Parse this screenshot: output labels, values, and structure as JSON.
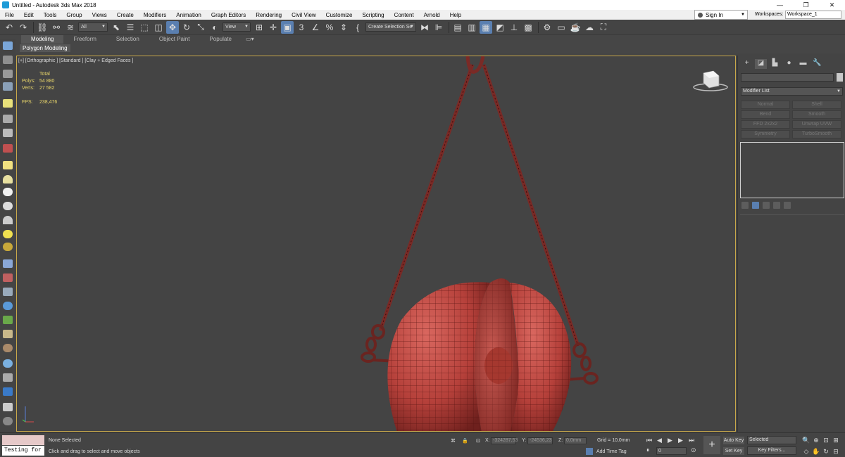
{
  "window": {
    "title": "Untitled - Autodesk 3ds Max 2018",
    "min": "—",
    "max": "❐",
    "close": "✕"
  },
  "menu": [
    "File",
    "Edit",
    "Tools",
    "Group",
    "Views",
    "Create",
    "Modifiers",
    "Animation",
    "Graph Editors",
    "Rendering",
    "Civil View",
    "Customize",
    "Scripting",
    "Content",
    "Arnold",
    "Help"
  ],
  "account": {
    "sign_in": "Sign In",
    "workspaces_label": "Workspaces:",
    "workspace": "Workspace_1"
  },
  "toolbar": {
    "selection_filter": "All",
    "ref_coord": "View",
    "named_selection": "Create Selection Se"
  },
  "ribbon": {
    "tabs": [
      "Modeling",
      "Freeform",
      "Selection",
      "Object Paint",
      "Populate"
    ],
    "active_tab": "Modeling",
    "sub_label": "Polygon Modeling"
  },
  "viewport": {
    "label": "[+] [Orthographic ] [Standard ] [Clay + Edged Faces ]",
    "stats": {
      "total_label": "Total",
      "polys_label": "Polys:",
      "polys": "54 880",
      "verts_label": "Verts:",
      "verts": "27 582",
      "fps_label": "FPS:",
      "fps": "238,476"
    }
  },
  "command_panel": {
    "modifier_list": "Modifier List",
    "modifiers": [
      "Normal",
      "Shell",
      "Bend",
      "Smooth",
      "FFD 2x2x2",
      "Unwrap UVW",
      "Symmetry",
      "TurboSmooth"
    ]
  },
  "status": {
    "script_input": "Testing for :",
    "selection": "None Selected",
    "prompt": "Click and drag to select and move objects",
    "x_label": "X:",
    "x": "-324287,53",
    "y_label": "Y:",
    "y": "-24536,23",
    "z_label": "Z:",
    "z": "0,0mm",
    "grid": "Grid = 10,0mm",
    "add_time_tag": "Add Time Tag",
    "frame": "0",
    "auto_key": "Auto Key",
    "set_key": "Set Key",
    "key_mode": "Selected",
    "key_filters": "Key Filters..."
  },
  "colors": {
    "accent": "#5a7fb0",
    "viewport_border": "#c8a84a",
    "stats_text": "#e8d56a",
    "model": "#b8433e"
  }
}
